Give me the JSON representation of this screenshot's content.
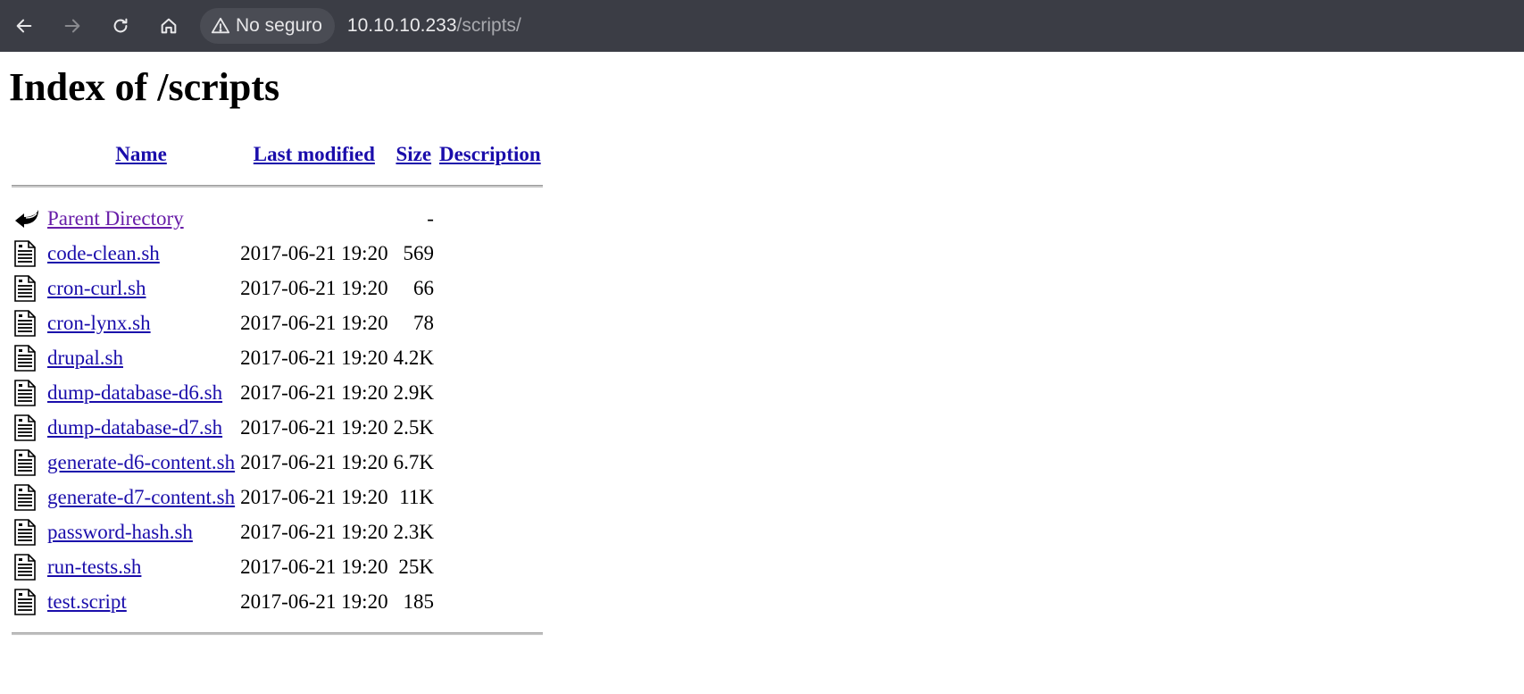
{
  "browser": {
    "security_label": "No seguro",
    "url_host": "10.10.10.233",
    "url_path": "/scripts/"
  },
  "page": {
    "title": "Index of /scripts",
    "columns": {
      "name": "Name",
      "last_modified": "Last modified",
      "size": "Size",
      "description": "Description"
    },
    "parent": {
      "name": "Parent Directory",
      "size": "-"
    },
    "files": [
      {
        "name": "code-clean.sh",
        "modified": "2017-06-21 19:20",
        "size": "569"
      },
      {
        "name": "cron-curl.sh",
        "modified": "2017-06-21 19:20",
        "size": "66"
      },
      {
        "name": "cron-lynx.sh",
        "modified": "2017-06-21 19:20",
        "size": "78"
      },
      {
        "name": "drupal.sh",
        "modified": "2017-06-21 19:20",
        "size": "4.2K"
      },
      {
        "name": "dump-database-d6.sh",
        "modified": "2017-06-21 19:20",
        "size": "2.9K"
      },
      {
        "name": "dump-database-d7.sh",
        "modified": "2017-06-21 19:20",
        "size": "2.5K"
      },
      {
        "name": "generate-d6-content.sh",
        "modified": "2017-06-21 19:20",
        "size": "6.7K"
      },
      {
        "name": "generate-d7-content.sh",
        "modified": "2017-06-21 19:20",
        "size": "11K"
      },
      {
        "name": "password-hash.sh",
        "modified": "2017-06-21 19:20",
        "size": "2.3K"
      },
      {
        "name": "run-tests.sh",
        "modified": "2017-06-21 19:20",
        "size": "25K"
      },
      {
        "name": "test.script",
        "modified": "2017-06-21 19:20",
        "size": "185"
      }
    ]
  }
}
